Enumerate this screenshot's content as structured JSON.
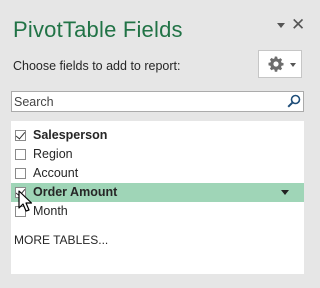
{
  "pane": {
    "title": "PivotTable Fields",
    "subtitle": "Choose fields to add to report:",
    "title_color": "#217346"
  },
  "search": {
    "placeholder": "Search",
    "value": ""
  },
  "fields": [
    {
      "label": "Salesperson",
      "checked": true,
      "bold": true
    },
    {
      "label": "Region",
      "checked": false,
      "bold": false
    },
    {
      "label": "Account",
      "checked": false,
      "bold": false
    },
    {
      "label": "Order Amount",
      "checked": true,
      "bold": true,
      "highlighted": true,
      "highlight_color": "#9fd5b7"
    },
    {
      "label": "Month",
      "checked": false,
      "bold": false
    }
  ],
  "more_tables": "MORE TABLES...",
  "icons": {
    "close": "close-icon",
    "pane_menu": "chevron-down-icon",
    "tools": "gear-icon",
    "search": "search-icon",
    "cursor": "mouse-pointer-icon"
  }
}
